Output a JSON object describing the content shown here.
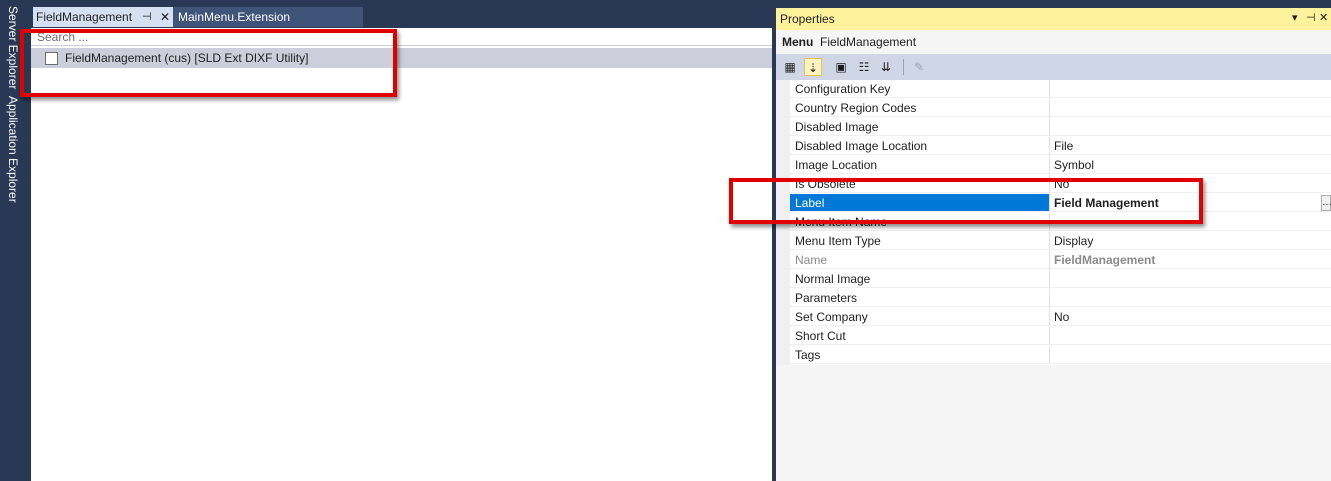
{
  "left_strip": {
    "tabs": [
      "Server Explorer",
      "Application Explorer"
    ]
  },
  "tabs": [
    {
      "label": "FieldManagement",
      "active": true,
      "pin_glyph": "⊣",
      "close_glyph": "✕"
    },
    {
      "label": "MainMenu.Extension",
      "active": false
    }
  ],
  "editor": {
    "search_placeholder": "Search ...",
    "tree_items": [
      {
        "label": "FieldManagement (cus) [SLD Ext DIXF Utility]"
      }
    ]
  },
  "properties": {
    "title": "Properties",
    "title_controls": [
      "▾",
      "⊣",
      "✕"
    ],
    "object_kind": "Menu",
    "object_name": "FieldManagement",
    "toolbar_icons": [
      "categorized-icon",
      "alphabetical-icon",
      "property-pages-icon",
      "events-icon",
      "sort-icon",
      "wrench-icon"
    ],
    "rows": [
      {
        "name": "Configuration Key",
        "value": ""
      },
      {
        "name": "Country Region Codes",
        "value": ""
      },
      {
        "name": "Disabled Image",
        "value": ""
      },
      {
        "name": "Disabled Image Location",
        "value": "File"
      },
      {
        "name": "Image Location",
        "value": "Symbol"
      },
      {
        "name": "Is Obsolete",
        "value": "No"
      },
      {
        "name": "Label",
        "value": "Field Management",
        "selected": true
      },
      {
        "name": "Menu Item Name",
        "value": ""
      },
      {
        "name": "Menu Item Type",
        "value": "Display"
      },
      {
        "name": "Name",
        "value": "FieldManagement",
        "readonly": true
      },
      {
        "name": "Normal Image",
        "value": ""
      },
      {
        "name": "Parameters",
        "value": ""
      },
      {
        "name": "Set Company",
        "value": "No"
      },
      {
        "name": "Short Cut",
        "value": ""
      },
      {
        "name": "Tags",
        "value": ""
      }
    ]
  },
  "colors": {
    "chrome": "#293955",
    "selection": "#0078d7",
    "properties_title_bg": "#fff29d",
    "annotation": "#e00000"
  }
}
